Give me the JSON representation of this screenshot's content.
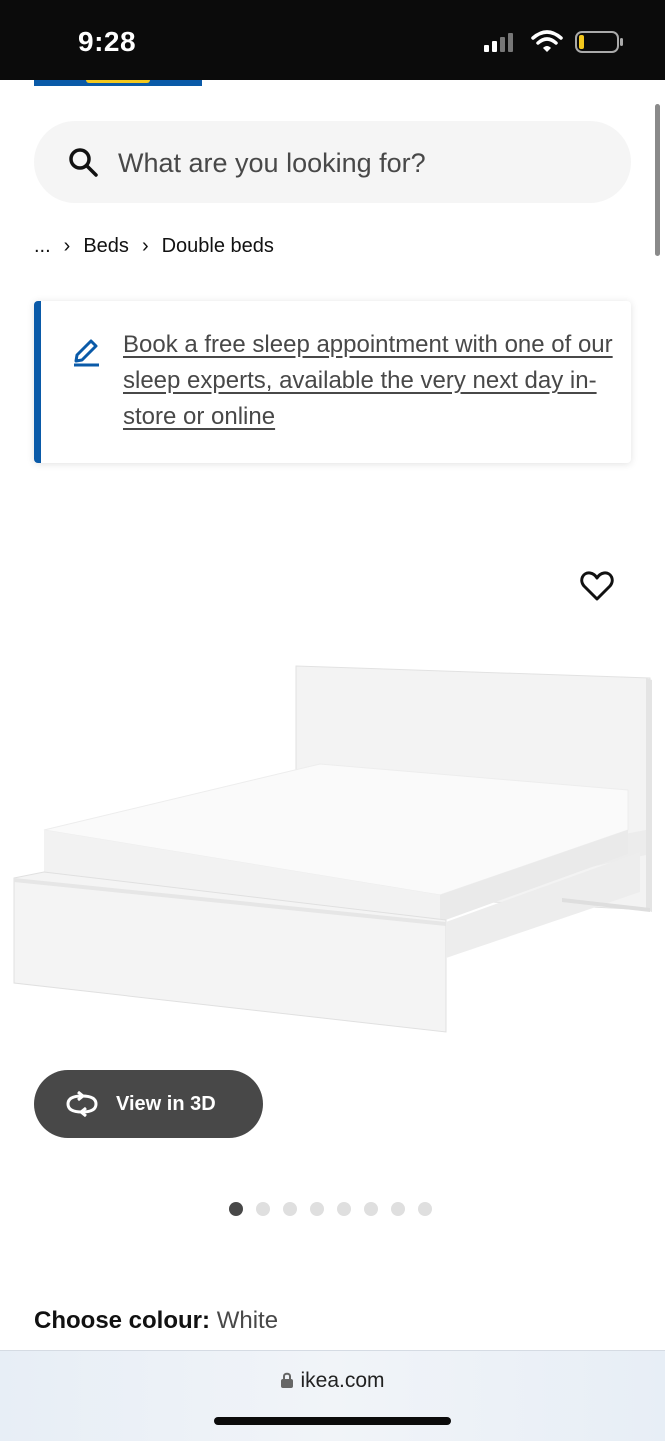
{
  "status_bar": {
    "time": "9:28"
  },
  "search": {
    "placeholder": "What are you looking for?"
  },
  "breadcrumb": {
    "items": [
      "...",
      "Beds",
      "Double beds"
    ]
  },
  "banner": {
    "text": "Book a free sleep appointment with one of our sleep experts, available the very next day in-store or online",
    "accent_color": "#0a5aa8"
  },
  "product": {
    "view_3d_label": "View in 3D",
    "image_count": 8,
    "active_image": 1
  },
  "colour": {
    "label": "Choose colour:",
    "value": "White"
  },
  "browser": {
    "url": "ikea.com"
  },
  "icons": [
    "search-icon",
    "pencil-icon",
    "heart-icon",
    "rotate-3d-icon",
    "lock-icon",
    "signal-icon",
    "wifi-icon",
    "battery-icon"
  ]
}
